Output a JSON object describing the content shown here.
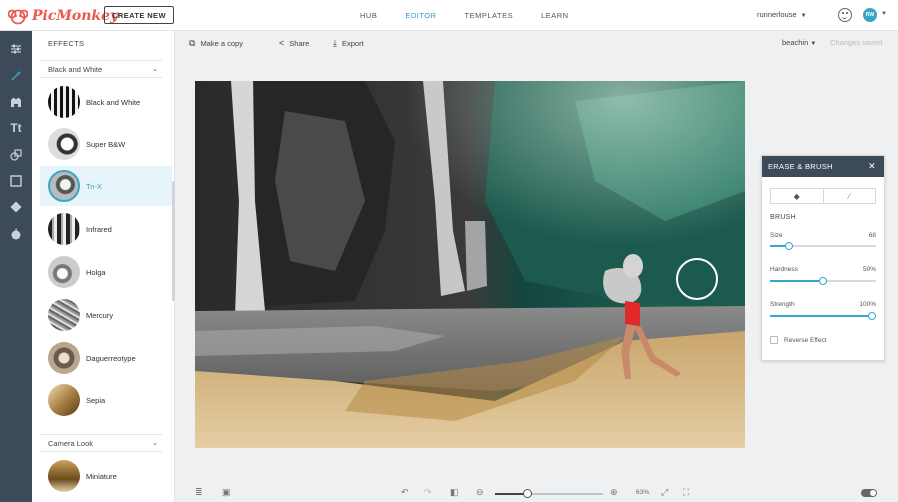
{
  "app": {
    "brand": "PicMonkey"
  },
  "header": {
    "create_label": "CREATE NEW",
    "nav": [
      {
        "label": "HUB",
        "active": false
      },
      {
        "label": "EDITOR",
        "active": true
      },
      {
        "label": "TEMPLATES",
        "active": false
      },
      {
        "label": "LEARN",
        "active": false
      }
    ],
    "username": "runnerlouse",
    "avatar_initials": "RW"
  },
  "rail_icons": [
    "sliders-icon",
    "wand-icon",
    "paw-icon",
    "text-icon",
    "shapes-icon",
    "frame-icon",
    "texture-icon",
    "apple-icon"
  ],
  "toolbar": {
    "make_copy": "Make a copy",
    "share": "Share",
    "export": "Export",
    "project_name": "beachin",
    "save_status": "Changes saved"
  },
  "effects_panel": {
    "title": "EFFECTS",
    "section1": "Black and White",
    "items": [
      {
        "label": "Black and White",
        "selected": false
      },
      {
        "label": "Super B&W",
        "selected": false
      },
      {
        "label": "Tri-X",
        "selected": true
      },
      {
        "label": "Infrared",
        "selected": false
      },
      {
        "label": "Holga",
        "selected": false
      },
      {
        "label": "Mercury",
        "selected": false
      },
      {
        "label": "Daguerreotype",
        "selected": false
      },
      {
        "label": "Sepia",
        "selected": false
      }
    ],
    "section2": "Camera Look",
    "items2": [
      {
        "label": "Miniature",
        "selected": false
      }
    ]
  },
  "erase_brush": {
    "title": "ERASE & BRUSH",
    "brush_label": "BRUSH",
    "size_label": "Size",
    "size_value": "68",
    "size_fraction": 0.18,
    "hardness_label": "Hardness",
    "hardness_value": "50%",
    "hardness_fraction": 0.5,
    "strength_label": "Strength",
    "strength_value": "100%",
    "strength_fraction": 1.0,
    "reverse_label": "Reverse Effect"
  },
  "bottom_bar": {
    "zoom_label": "63%",
    "zoom_fraction": 0.3
  },
  "colors": {
    "accent": "#3aa5c9",
    "rail": "#3d4a5a",
    "brand": "#e85a4f"
  }
}
